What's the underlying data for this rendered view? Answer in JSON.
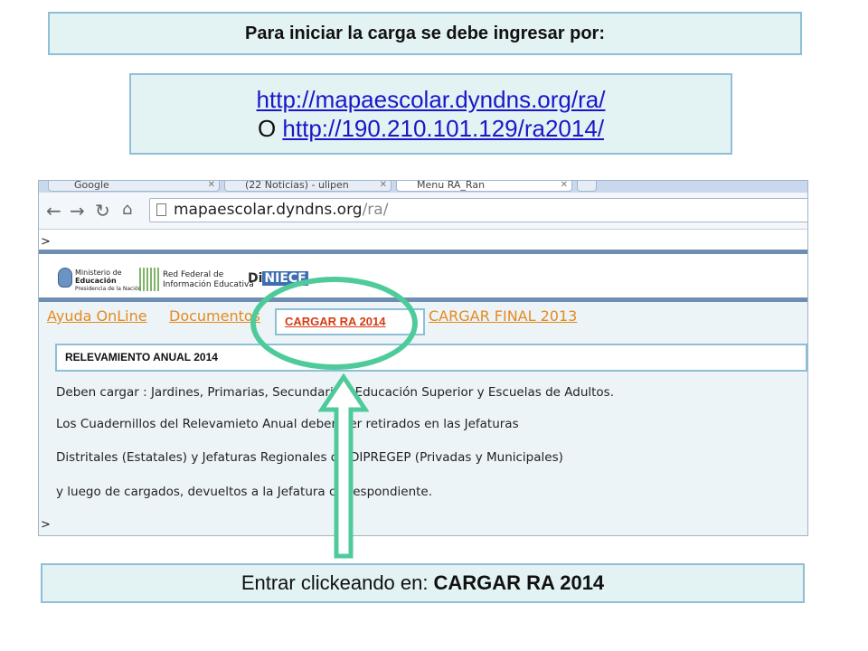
{
  "header": {
    "title": "Para iniciar la carga se debe ingresar por:"
  },
  "urls": {
    "primary": "http://mapaescolar.dyndns.org/ra/",
    "alt_prefix": "O",
    "secondary": "http://190.210.101.129/ra2014/"
  },
  "browser": {
    "tabs": [
      {
        "label": "Google"
      },
      {
        "label": "(22 Noticias) - ulipen"
      },
      {
        "label": "Menu RA_Ran"
      }
    ],
    "address_host": "mapaescolar.dyndns.org",
    "address_path": "/ra/",
    "prompt": ">",
    "logos": {
      "ministry_line1": "Ministerio de",
      "ministry_line2": "Educación",
      "ministry_line3": "Presidencia de la Nación",
      "red_line1": "Red Federal de",
      "red_line2": "Información Educativa",
      "dinfece_a": "Di",
      "dinfece_b": "NIECE"
    },
    "menu": {
      "ayuda": "Ayuda OnLine",
      "documentos": "Documentos",
      "cargar_ra": "CARGAR RA 2014",
      "cargar_final": "CARGAR FINAL 2013"
    },
    "relevamiento_title": "RELEVAMIENTO ANUAL 2014",
    "paragraphs": [
      "Deben cargar : Jardines, Primarias, Secundarias, Educación Superior y Escuelas de Adultos.",
      "Los Cuadernillos del Relevamieto Anual deben ser retirados en las Jefaturas",
      "Distritales (Estatales) y Jefaturas Regionales de DIPREGEP (Privadas y Municipales)",
      "y luego de cargados, devueltos a la Jefatura correspondiente."
    ]
  },
  "footer": {
    "instruction": "Entrar clickeando en:",
    "target": "CARGAR RA 2014"
  },
  "colors": {
    "box_fill": "#e3f2f3",
    "box_border": "#8ebfd6",
    "link_blue": "#1a17c9",
    "menu_orange": "#e58a1f",
    "cargar_red": "#d63b14",
    "annotation_green": "#4fcb9b"
  }
}
